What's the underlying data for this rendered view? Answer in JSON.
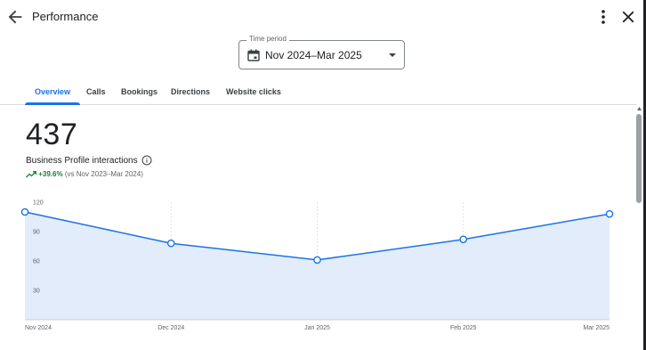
{
  "header": {
    "title": "Performance",
    "back_icon": "arrow-back-icon",
    "more_icon": "more-vert-icon",
    "close_icon": "close-icon"
  },
  "time_period": {
    "label": "Time period",
    "value": "Nov 2024–Mar 2025",
    "icon": "calendar-icon"
  },
  "tabs": [
    {
      "label": "Overview",
      "active": true
    },
    {
      "label": "Calls",
      "active": false
    },
    {
      "label": "Bookings",
      "active": false
    },
    {
      "label": "Directions",
      "active": false
    },
    {
      "label": "Website clicks",
      "active": false
    }
  ],
  "metric": {
    "value": "437",
    "label": "Business Profile interactions",
    "change": "+39.6%",
    "comparison": "(vs Nov 2023–Mar 2024)"
  },
  "colors": {
    "accent": "#1a73e8",
    "positive": "#188038",
    "area_fill": "#e3ecfa"
  },
  "chart_data": {
    "type": "area",
    "x": [
      "Nov 2024",
      "Dec 2024",
      "Jan 2025",
      "Feb 2025",
      "Mar 2025"
    ],
    "series": [
      {
        "values": [
          110,
          78,
          61,
          82,
          108
        ]
      }
    ],
    "yticks": [
      120,
      90,
      60,
      30
    ],
    "ylim": [
      0,
      120
    ],
    "grid": "vertical dashed"
  }
}
